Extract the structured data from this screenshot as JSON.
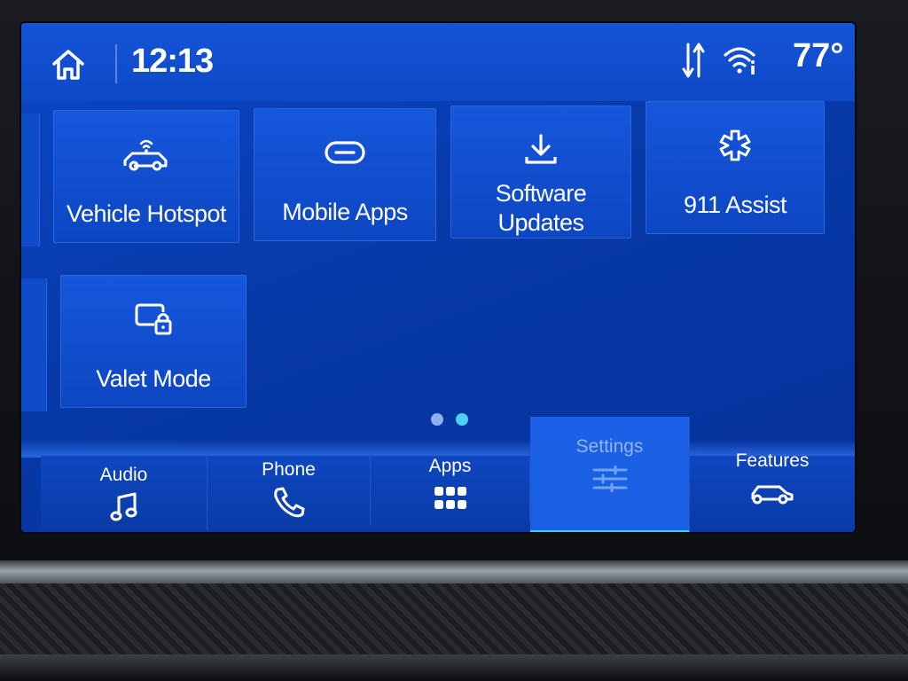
{
  "status_bar": {
    "time": "12:13",
    "temperature": "77°",
    "icons": [
      "home-icon",
      "data-transfer-icon",
      "wifi-info-icon"
    ]
  },
  "tiles": [
    {
      "label": "Vehicle Hotspot",
      "icon": "vehicle-hotspot-icon"
    },
    {
      "label": "Mobile Apps",
      "icon": "link-icon"
    },
    {
      "label_line1": "Software",
      "label_line2": "Updates",
      "icon": "download-icon"
    },
    {
      "label": "911 Assist",
      "icon": "emergency-star-icon"
    },
    {
      "label": "Valet Mode",
      "icon": "valet-lock-icon"
    }
  ],
  "page_indicator": {
    "total": 2,
    "current": 2
  },
  "bottom_nav": [
    {
      "label": "Audio",
      "icon": "music-note-icon"
    },
    {
      "label": "Phone",
      "icon": "phone-icon"
    },
    {
      "label": "Apps",
      "icon": "apps-grid-icon"
    },
    {
      "label": "Settings",
      "icon": "sliders-icon",
      "selected": true
    },
    {
      "label": "Features",
      "icon": "car-icon"
    }
  ],
  "colors": {
    "screen_bg": "#0b47c9",
    "tile_bg": "#1657dc",
    "accent_cyan": "#3ad0f4",
    "text": "#ffffff"
  }
}
